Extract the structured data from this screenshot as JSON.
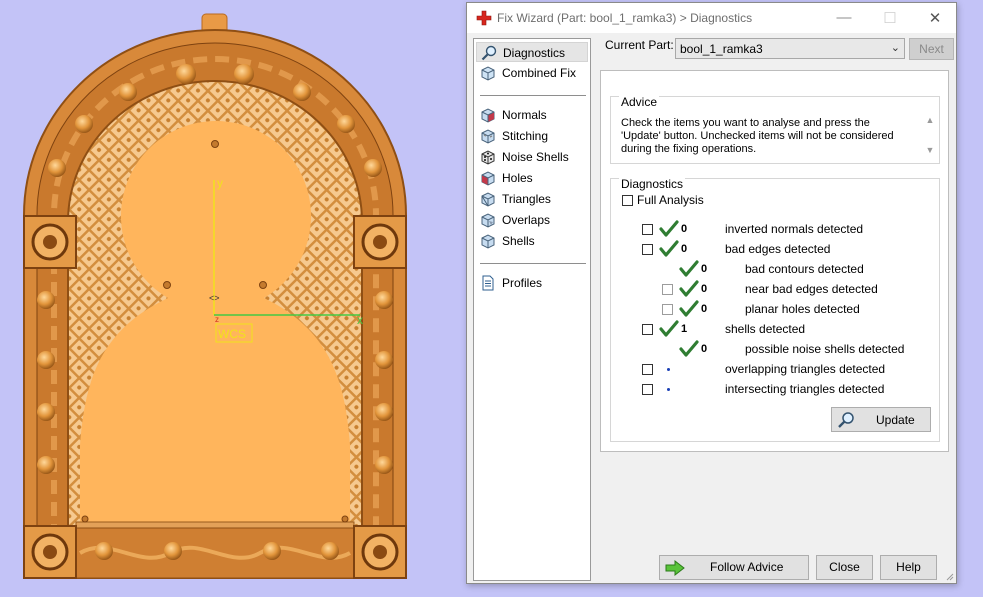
{
  "viewport": {
    "axis_y_label": "y",
    "axis_x_label": "x",
    "wcs_label": "WCS"
  },
  "window": {
    "title": "Fix Wizard (Part: bool_1_ramka3) > Diagnostics",
    "icon": "red-cross-icon",
    "controls": {
      "minimize": "—",
      "maximize": "☐",
      "close": "✕"
    }
  },
  "nav": {
    "items": [
      {
        "label": "Diagnostics",
        "icon": "diagnostics-magnifier-icon",
        "selected": true
      },
      {
        "label": "Combined Fix",
        "icon": "combined-fix-cube-icon"
      },
      {
        "label": "Normals",
        "icon": "normals-cube-icon"
      },
      {
        "label": "Stitching",
        "icon": "stitching-cube-icon"
      },
      {
        "label": "Noise Shells",
        "icon": "noise-shells-dice-icon"
      },
      {
        "label": "Holes",
        "icon": "holes-cube-icon"
      },
      {
        "label": "Triangles",
        "icon": "triangles-cube-icon"
      },
      {
        "label": "Overlaps",
        "icon": "overlaps-cube-icon"
      },
      {
        "label": "Shells",
        "icon": "shells-cube-icon"
      },
      {
        "label": "Profiles",
        "icon": "profiles-document-icon"
      }
    ]
  },
  "current_part": {
    "label": "Current Part:",
    "value": "bool_1_ramka3",
    "next_label": "Next"
  },
  "advice": {
    "title": "Advice",
    "text": "Check the items you want to analyse and press the 'Update' button. Unchecked items will not be considered during the fixing operations."
  },
  "diagnostics": {
    "title": "Diagnostics",
    "full_analysis_label": "Full Analysis",
    "rows": [
      {
        "checked": false,
        "status": "ok",
        "count": "0",
        "label": "inverted normals detected"
      },
      {
        "checked": false,
        "status": "ok",
        "count": "0",
        "label": "bad edges detected"
      },
      {
        "status": "ok",
        "count": "0",
        "label": "bad contours detected"
      },
      {
        "checked": false,
        "status": "ok",
        "count": "0",
        "label": "near bad edges detected"
      },
      {
        "checked": false,
        "status": "ok",
        "count": "0",
        "label": "planar holes detected"
      },
      {
        "checked": false,
        "status": "ok",
        "count": "1",
        "label": "shells detected"
      },
      {
        "status": "ok",
        "count": "0",
        "label": "possible noise shells detected"
      },
      {
        "checked": false,
        "status": "pending",
        "count": "",
        "label": "overlapping triangles detected"
      },
      {
        "checked": false,
        "status": "pending",
        "count": "",
        "label": "intersecting triangles detected"
      }
    ],
    "update_label": "Update"
  },
  "buttons": {
    "follow_advice": "Follow Advice",
    "close": "Close",
    "help": "Help"
  },
  "colors": {
    "viewport_background": "#c3c3f7",
    "part_gold": "#f0ac52",
    "check_green": "#2f7d32",
    "axis_yellow": "#f2e21c",
    "axis_green": "#43c943"
  }
}
